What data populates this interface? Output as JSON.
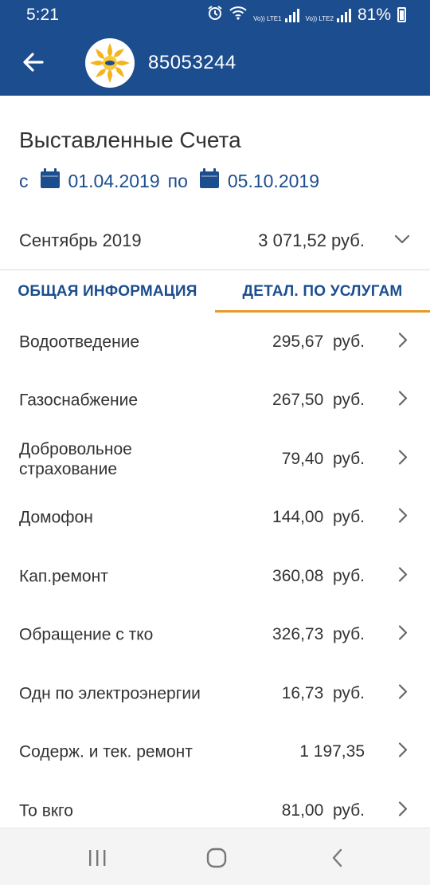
{
  "status_bar": {
    "time": "5:21",
    "sim1_label": "Vo)) LTE1",
    "sim2_label": "Vo)) LTE2",
    "battery": "81%",
    "icons": [
      "alarm-icon",
      "wifi-icon",
      "signal-icon",
      "battery-icon"
    ]
  },
  "app_bar": {
    "account_number": "85053244",
    "back_icon": "arrow-left-icon",
    "logo_icon": "sun-logo-icon"
  },
  "page": {
    "title": "Выставленные Счета",
    "from_label": "с",
    "from_date": "01.04.2019",
    "to_label": "по",
    "to_date": "05.10.2019"
  },
  "month": {
    "label": "Сентябрь 2019",
    "amount": "3 071,52  руб."
  },
  "tabs": [
    {
      "label": "ОБЩАЯ ИНФОРМАЦИЯ",
      "active": false
    },
    {
      "label": "ДЕТАЛ. ПО УСЛУГАМ",
      "active": true
    }
  ],
  "services": [
    {
      "name": "Водоотведение",
      "value": "295,67  руб."
    },
    {
      "name": "Газоснабжение",
      "value": "267,50  руб."
    },
    {
      "name": "Добровольное страхование",
      "value": "79,40  руб."
    },
    {
      "name": "Домофон",
      "value": "144,00  руб."
    },
    {
      "name": "Кап.ремонт",
      "value": "360,08  руб."
    },
    {
      "name": "Обращение с тко",
      "value": "326,73  руб."
    },
    {
      "name": "Одн по электроэнергии",
      "value": "16,73  руб."
    },
    {
      "name": "Содерж. и тек. ремонт",
      "value": "1 197,35"
    },
    {
      "name": "То вкго",
      "value": "81,00  руб."
    }
  ],
  "colors": {
    "primary": "#1c4d8f",
    "accent": "#e79a2a",
    "text": "#333333"
  }
}
